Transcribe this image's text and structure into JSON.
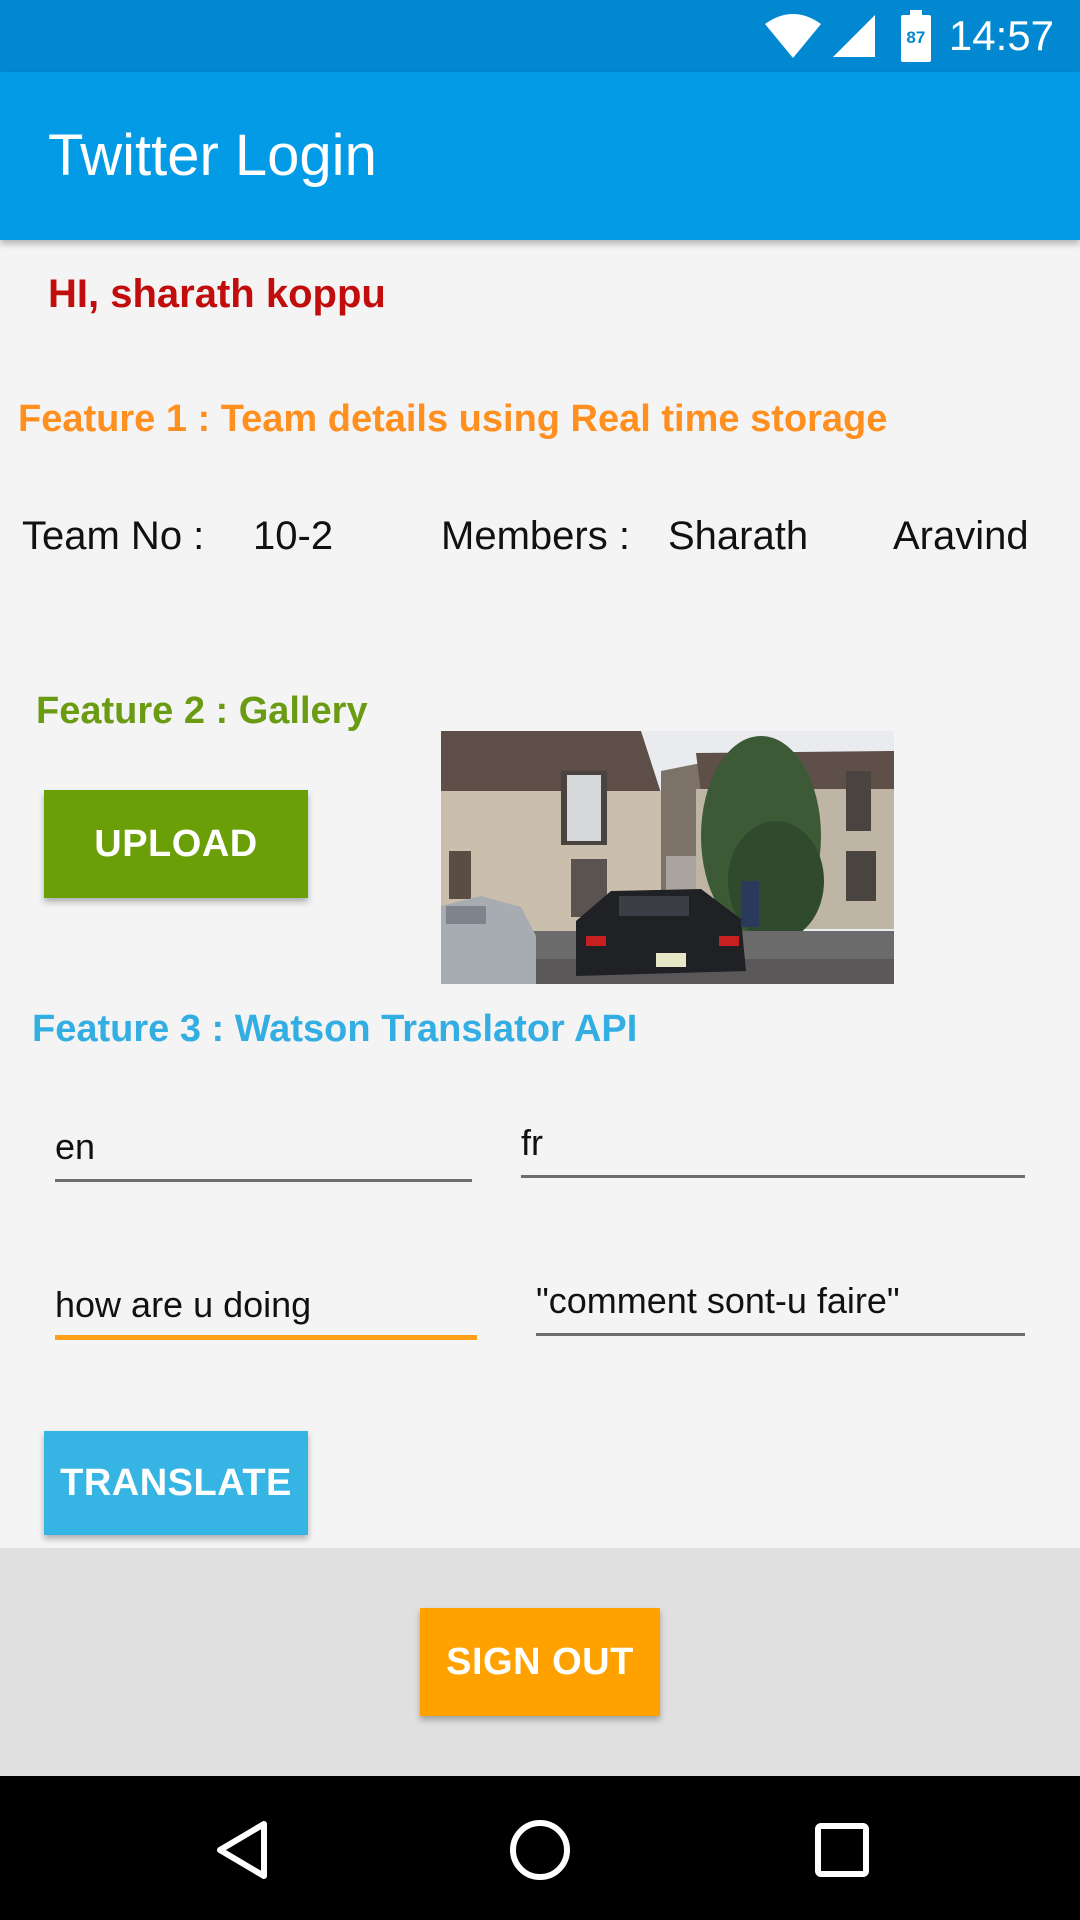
{
  "status_bar": {
    "time": "14:57",
    "battery_level": "87",
    "icons": [
      "wifi-icon",
      "signal-icon",
      "battery-icon"
    ]
  },
  "app_bar": {
    "title": "Twitter Login"
  },
  "greeting": "HI, sharath koppu",
  "feature1": {
    "heading": "Feature 1 : Team details using Real time storage",
    "team_label": "Team No :",
    "team_value": "10-2",
    "members_label": "Members :",
    "member1": "Sharath",
    "member2": "Aravind"
  },
  "feature2": {
    "heading": "Feature 2 : Gallery",
    "upload_label": "UPLOAD"
  },
  "feature3": {
    "heading": "Feature 3 : Watson Translator API",
    "source_lang": "en",
    "target_lang": "fr",
    "source_text": "how are u doing",
    "translated_text": "\"comment sont-u faire\"",
    "translate_label": "TRANSLATE"
  },
  "signout_label": "SIGN OUT",
  "nav_bar": {
    "icons": [
      "back-icon",
      "home-icon",
      "recents-icon"
    ]
  },
  "colors": {
    "status_bar": "#0288d1",
    "app_bar": "#039be5",
    "greeting": "#c20d0d",
    "feature1": "#ff8f1f",
    "feature2": "#6a9b13",
    "feature3": "#33aee2",
    "upload_button": "#6a9f07",
    "translate_button": "#36b5e5",
    "signout_button": "#ffa200",
    "active_field": "#ff9f1a"
  }
}
